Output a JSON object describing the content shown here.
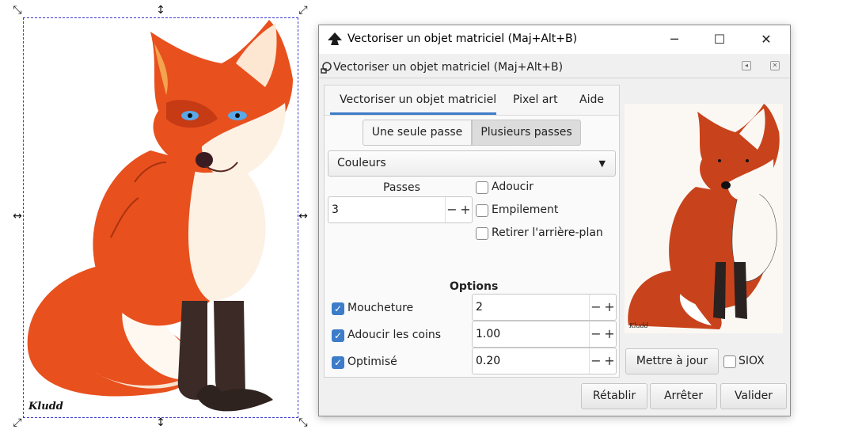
{
  "canvas": {
    "signature": "Kludd"
  },
  "window": {
    "title": "Vectoriser un objet matriciel (Maj+Alt+B)",
    "minimize_icon": "minimize-icon",
    "maximize_icon": "maximize-icon",
    "close_icon": "close-icon"
  },
  "panel_header": {
    "title": "Vectoriser un objet matriciel (Maj+Alt+B)"
  },
  "tabs": [
    {
      "label": "Vectoriser un objet matriciel",
      "active": true
    },
    {
      "label": "Pixel art",
      "active": false
    },
    {
      "label": "Aide",
      "active": false
    }
  ],
  "mode": {
    "single_label": "Une seule passe",
    "multi_label": "Plusieurs passes",
    "selected": "Plusieurs passes"
  },
  "detection": {
    "selected": "Couleurs"
  },
  "passes": {
    "label": "Passes",
    "value": "3"
  },
  "multi_options": [
    {
      "label": "Adoucir",
      "checked": false
    },
    {
      "label": "Empilement",
      "checked": false
    },
    {
      "label": "Retirer l'arrière-plan",
      "checked": false
    }
  ],
  "options": {
    "heading": "Options",
    "rows": [
      {
        "label": "Moucheture",
        "checked": true,
        "value": "2"
      },
      {
        "label": "Adoucir les coins",
        "checked": true,
        "value": "1.00"
      },
      {
        "label": "Optimisé",
        "checked": true,
        "value": "0.20"
      }
    ]
  },
  "preview": {
    "update_label": "Mettre à jour",
    "siox_label": "SIOX",
    "siox_checked": false,
    "signature": "Kludd"
  },
  "footer": {
    "reset_label": "Rétablir",
    "stop_label": "Arrêter",
    "ok_label": "Valider"
  },
  "colors": {
    "accent": "#3d7cc9",
    "fox_orange": "#e8501e",
    "fox_dark": "#3b2a26"
  }
}
